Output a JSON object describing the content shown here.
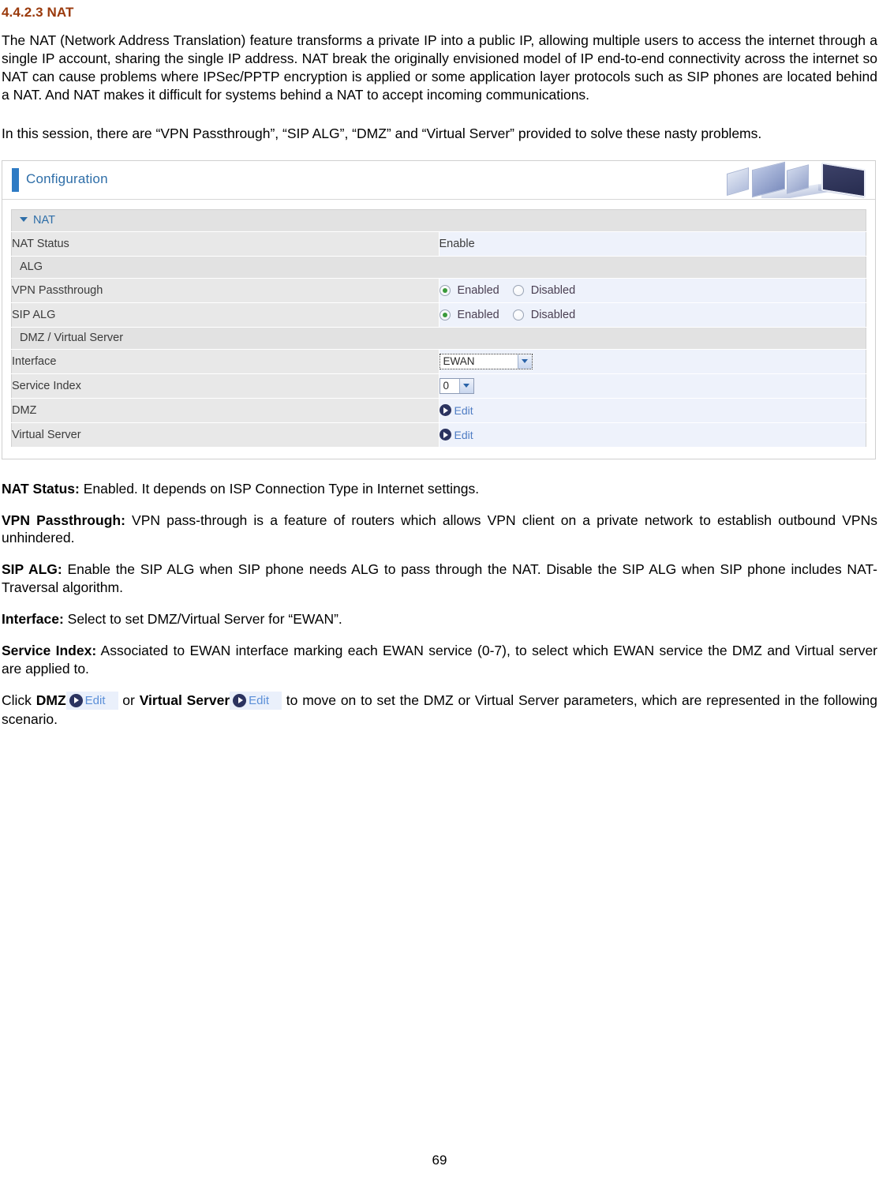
{
  "document": {
    "heading": "4.4.2.3 NAT",
    "page_number": "69",
    "paragraphs": {
      "intro": "The NAT (Network Address Translation) feature transforms a private IP into a public IP, allowing multiple users to access the internet through a single IP account, sharing the single IP address. NAT break the originally envisioned model of IP end-to-end connectivity across the internet so NAT can cause problems where IPSec/PPTP encryption is applied or some application layer protocols such as SIP phones are located behind a NAT. And NAT makes it difficult for systems behind a NAT to accept incoming communications.",
      "session": "In this session, there are “VPN Passthrough”, “SIP ALG”, “DMZ” and “Virtual Server” provided to solve these nasty problems."
    },
    "definitions": [
      {
        "term": "NAT Status:",
        "text": " Enabled. It depends on ISP Connection Type in Internet settings."
      },
      {
        "term": "VPN Passthrough:",
        "text": " VPN pass-through is a feature of routers which allows VPN client on a private network to establish outbound VPNs unhindered."
      },
      {
        "term": "SIP ALG:",
        "text": " Enable the SIP ALG when SIP phone needs ALG to pass through the NAT. Disable the SIP ALG when SIP phone includes NAT-Traversal algorithm."
      },
      {
        "term": "Interface:",
        "text": " Select to set DMZ/Virtual Server for “EWAN”."
      },
      {
        "term": "Service Index:",
        "text": " Associated to EWAN interface marking each EWAN service (0-7), to select which EWAN service the DMZ and Virtual server are applied to."
      }
    ],
    "click_paragraph": {
      "lead": "Click ",
      "term_dmz": "DMZ",
      "edit_label_1": "Edit",
      "mid": " or ",
      "term_virtual_server": "Virtual Server",
      "edit_label_2": "Edit",
      "tail": " to move on to set the DMZ or Virtual Server parameters, which are represented in the following scenario."
    }
  },
  "config_panel": {
    "header": {
      "title": "Configuration",
      "accent_color": "#2E7BC4"
    },
    "section": {
      "title": "NAT",
      "expanded": true
    },
    "rows": [
      {
        "type": "value",
        "label": "NAT Status",
        "value": "Enable"
      },
      {
        "type": "group",
        "label": "ALG"
      },
      {
        "type": "radio",
        "label": "VPN Passthrough",
        "options": [
          "Enabled",
          "Disabled"
        ],
        "selected": "Enabled"
      },
      {
        "type": "radio",
        "label": "SIP ALG",
        "options": [
          "Enabled",
          "Disabled"
        ],
        "selected": "Enabled"
      },
      {
        "type": "group",
        "label": "DMZ / Virtual Server"
      },
      {
        "type": "select",
        "label": "Interface",
        "value": "EWAN",
        "focused": true
      },
      {
        "type": "select",
        "label": "Service Index",
        "value": "0",
        "focused": false
      },
      {
        "type": "link",
        "label": "DMZ",
        "value": "Edit"
      },
      {
        "type": "link",
        "label": "Virtual Server",
        "value": "Edit"
      }
    ],
    "colors": {
      "label_cell": "#e8e8e8",
      "value_cell": "#eef2fb",
      "group_cell": "#e2e2e2",
      "section_title": "#2E6EA8",
      "radio_dot": "#3a9a3a",
      "link_text": "#4f7dc4"
    }
  }
}
